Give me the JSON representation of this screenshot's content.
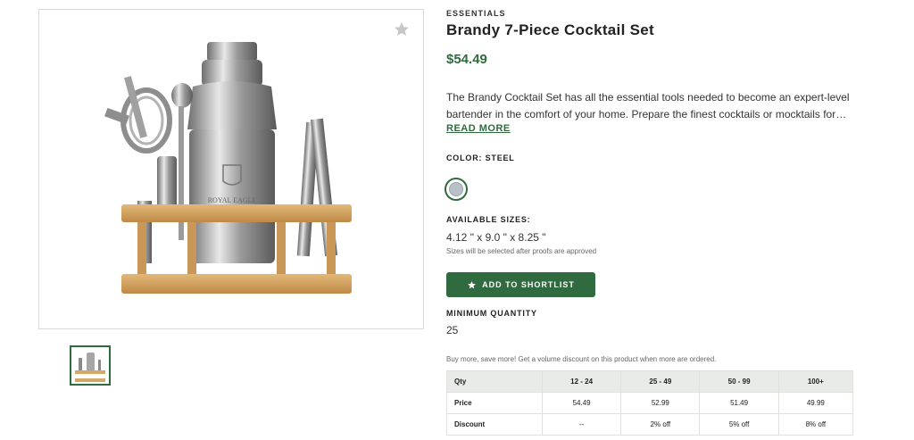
{
  "product": {
    "brand": "ESSENTIALS",
    "title": "Brandy 7-Piece Cocktail Set",
    "price": "$54.49",
    "description": "The Brandy Cocktail Set has all the essential tools needed to become an expert-level bartender in the comfort of your home. Prepare the finest cocktails or mocktails for…",
    "read_more": "READ MORE",
    "image_logo_text": "ROYAL EAGLE"
  },
  "color": {
    "label": "COLOR: STEEL",
    "swatch_hex": "#b9c1c8"
  },
  "sizes": {
    "label": "AVAILABLE SIZES:",
    "value": "4.12 \" x 9.0 \" x 8.25 \"",
    "note": "Sizes will be selected after proofs are approved"
  },
  "actions": {
    "shortlist_label": "ADD TO SHORTLIST"
  },
  "minimum": {
    "label": "MINIMUM QUANTITY",
    "value": "25"
  },
  "pricing": {
    "note": "Buy more, save more! Get a volume discount on this product when more are ordered.",
    "header": [
      "Qty",
      "12 - 24",
      "25 - 49",
      "50 - 99",
      "100+"
    ],
    "rows": [
      [
        "Price",
        "54.49",
        "52.99",
        "51.49",
        "49.99"
      ],
      [
        "Discount",
        "--",
        "2% off",
        "5% off",
        "8% off"
      ]
    ]
  },
  "icons": {
    "favorite": "star-icon",
    "shortlist": "star-icon"
  },
  "colors": {
    "accent": "#2f6b3e",
    "table_header_bg": "#e8ebe8"
  }
}
